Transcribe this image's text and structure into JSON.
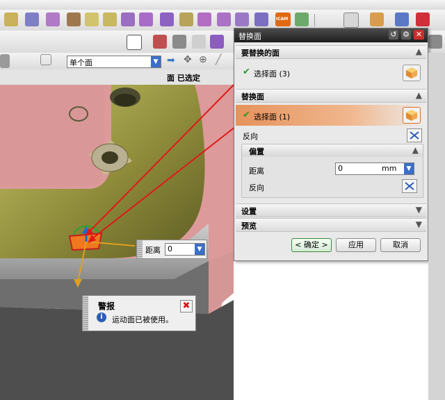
{
  "toolbar": {
    "selection_filter_value": "单个面",
    "selection_status": "面 已选定",
    "icam_label": "ICAM"
  },
  "dialog": {
    "title": "替换面",
    "sections": {
      "faces_to_replace": {
        "label": "要替换的面",
        "select_label": "选择面 (3)"
      },
      "replacement_face": {
        "label": "替换面",
        "select_label": "选择面 (1)",
        "reverse_label": "反向"
      },
      "offset": {
        "label": "偏置",
        "distance_label": "距离",
        "distance_value": "0",
        "unit": "mm",
        "reverse_label": "反向"
      },
      "settings": {
        "label": "设置"
      },
      "preview": {
        "label": "预览"
      }
    },
    "buttons": {
      "ok": "< 确定 >",
      "apply": "应用",
      "cancel": "取消"
    }
  },
  "distance_popup": {
    "label": "距离",
    "value": "0"
  },
  "alert": {
    "title": "警报",
    "message": "运动面已被使用。"
  },
  "colors": {
    "face_pink": "#dc9a9a",
    "part_olive": "#a5a248",
    "selection_orange": "#f0b078",
    "arrow_red": "#e01818",
    "title_dark": "#2a2a2a"
  },
  "icons": [
    "undo-icon",
    "gear-icon",
    "close-icon",
    "cube-select-icon",
    "reverse-direction-icon",
    "info-icon",
    "alert-close-icon"
  ]
}
